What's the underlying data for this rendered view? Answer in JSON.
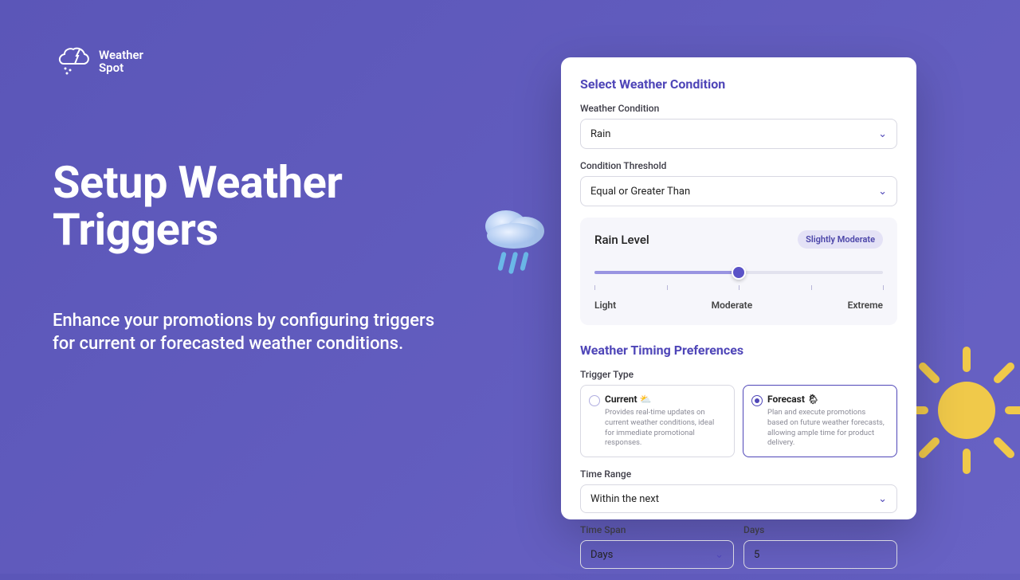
{
  "brand_line1": "Weather",
  "brand_line2": "Spot",
  "hero_title_line1": "Setup Weather",
  "hero_title_line2": "Triggers",
  "hero_subtitle": "Enhance your promotions by configuring triggers\nfor current or forecasted weather conditions.",
  "condition": {
    "section_title": "Select Weather Condition",
    "condition_label": "Weather Condition",
    "condition_value": "Rain",
    "threshold_label": "Condition Threshold",
    "threshold_value": "Equal or Greater Than",
    "level_title": "Rain Level",
    "level_badge": "Slightly Moderate",
    "level_labels": [
      "Light",
      "Moderate",
      "Extreme"
    ]
  },
  "timing": {
    "section_title": "Weather Timing Preferences",
    "trigger_type_label": "Trigger Type",
    "options": [
      {
        "title": "Current ⛅",
        "desc": "Provides real-time updates on current weather conditions, ideal for immediate promotional responses.",
        "selected": false
      },
      {
        "title": "Forecast 🌦",
        "desc": "Plan and execute promotions based on future weather forecasts, allowing ample time for product delivery.",
        "selected": true
      }
    ],
    "time_range_label": "Time Range",
    "time_range_value": "Within the next",
    "time_span_label": "Time Span",
    "time_span_value": "Days",
    "days_label": "Days",
    "days_value": "5"
  }
}
